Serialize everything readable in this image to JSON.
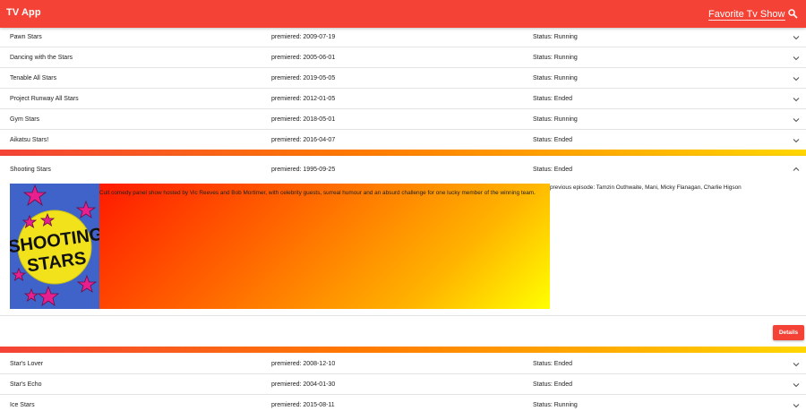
{
  "app": {
    "title": "TV App"
  },
  "search": {
    "placeholder": "Favorite Tv Show"
  },
  "shows_top": [
    {
      "name": "Pawn Stars",
      "premiered": "premiered: 2009-07-19",
      "status": "Status: Running"
    },
    {
      "name": "Dancing with the Stars",
      "premiered": "premiered: 2005-06-01",
      "status": "Status: Running"
    },
    {
      "name": "Tenable All Stars",
      "premiered": "premiered: 2019-05-05",
      "status": "Status: Running"
    },
    {
      "name": "Project Runway All Stars",
      "premiered": "premiered: 2012-01-05",
      "status": "Status: Ended"
    },
    {
      "name": "Gym Stars",
      "premiered": "premiered: 2018-05-01",
      "status": "Status: Running"
    },
    {
      "name": "Aikatsu Stars!",
      "premiered": "premiered: 2016-04-07",
      "status": "Status: Ended"
    }
  ],
  "expanded": {
    "name": "Shooting Stars",
    "premiered": "premiered: 1995-09-25",
    "status": "Status: Ended",
    "poster_text": [
      "SHOOTING",
      "STARS"
    ],
    "summary": "Cult comedy panel show hosted by Vic Reeves and Bob Mortimer, with celebrity guests, surreal humour and an absurd challenge for one lucky member of the winning team.",
    "previous_episode": "previous episode: Tamzin Outhwaite, Mani, Micky Flanagan, Charlie Higson",
    "details_label": "Details"
  },
  "shows_bottom": [
    {
      "name": "Star's Lover",
      "premiered": "premiered: 2008-12-10",
      "status": "Status: Ended"
    },
    {
      "name": "Star's Echo",
      "premiered": "premiered: 2004-01-30",
      "status": "Status: Ended"
    },
    {
      "name": "Ice Stars",
      "premiered": "premiered: 2015-08-11",
      "status": "Status: Running"
    }
  ],
  "colors": {
    "primary": "#f44336",
    "gradient_end": "#ffd600"
  },
  "icons": {
    "search": "search-icon",
    "expand": "chevron-down-icon",
    "collapse": "chevron-up-icon"
  }
}
